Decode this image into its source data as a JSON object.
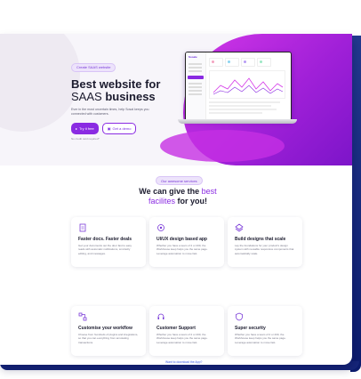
{
  "hero": {
    "pill": "Create SAAS website",
    "title_line1": "Best website for",
    "title_light": "SAAS",
    "title_bold": "business",
    "lead": "Ever in the most uncertain times, help Sosal keeps you connected with customers.",
    "try_button": "Try it free",
    "demo_button": "Get a demo",
    "note": "No credit card required*"
  },
  "dashboard": {
    "logo": "Sosale",
    "nav_active": "Dashboard"
  },
  "services": {
    "pill": "Our awesome services",
    "title_line1": "We can give the",
    "title_accent": "best",
    "title_line2_light": "facilites",
    "title_line2_bold": "for you!",
    "cards": [
      {
        "title": "Faster docs. Faster deals",
        "desc": "Get your documents out the door fast to easy reads with automatic notifications, smi-facily editing, and messages."
      },
      {
        "title": "UI/UX design based app",
        "desc": "Whether you have a team of 2 or 200, the Workhouse keep helps you the same page. Leverage automation to move fast."
      },
      {
        "title": "Build designs that scale",
        "desc": "Lay the foundations for your product's design system with reusable responsive components that automatically scale."
      },
      {
        "title": "Customise your workflow",
        "desc": "Choose from hundreds of plugins and integrations, so that you can everything from annotating transactions."
      },
      {
        "title": "Customer Support",
        "desc": "Whether you have a team of 2 or 200, the Workhouse keep helps you the same page. Leverage automation to move fast."
      },
      {
        "title": "Super security",
        "desc": "Whether you have a team of 2 or 200, the Workhouse keep helps you the same page. Leverage automation to move fast."
      }
    ],
    "footer_link": "Want to download the App?"
  },
  "colors": {
    "accent": "#8a2be2",
    "brand_gradient_start": "#d437e8",
    "brand_gradient_end": "#7a14c8"
  }
}
